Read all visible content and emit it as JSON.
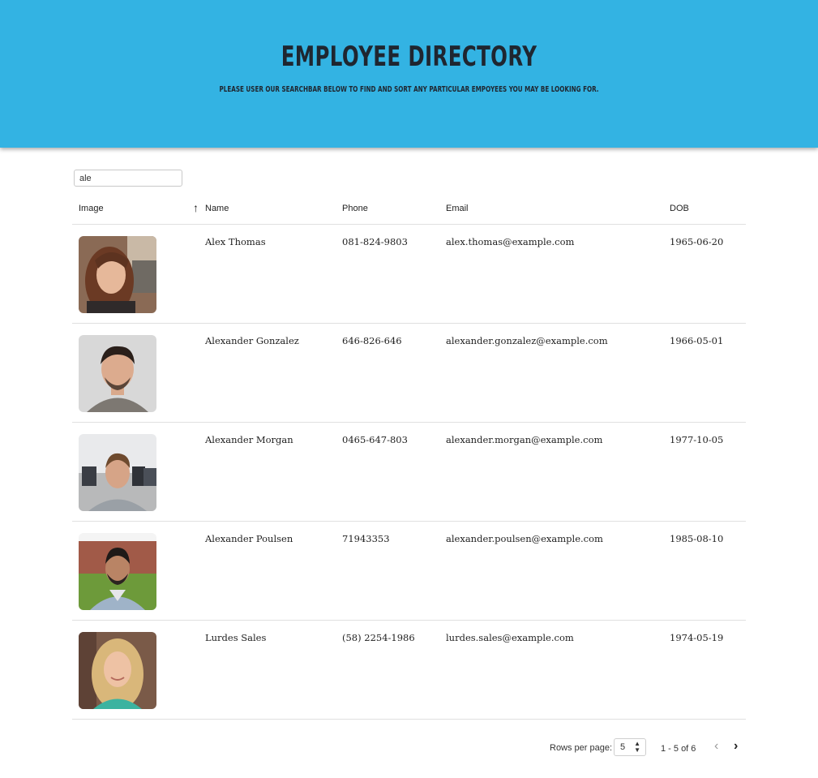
{
  "header": {
    "title": "EMPLOYEE DIRECTORY",
    "subtitle": "PLEASE USER OUR SEARCHBAR BELOW TO FIND AND SORT ANY PARTICULAR EMPOYEES YOU MAY BE LOOKING FOR.",
    "background_color": "#33b3e3"
  },
  "search": {
    "value": "ale"
  },
  "table": {
    "columns": [
      "Image",
      "Name",
      "Phone",
      "Email",
      "DOB"
    ],
    "sort": {
      "column": "Name",
      "direction": "ascending",
      "icon": "arrow-up-icon"
    },
    "rows": [
      {
        "image": "employee-photo",
        "name": "Alex Thomas",
        "phone": "081-824-9803",
        "email": "alex.thomas@example.com",
        "dob": "1965-06-20"
      },
      {
        "image": "employee-photo",
        "name": "Alexander Gonzalez",
        "phone": "646-826-646",
        "email": "alexander.gonzalez@example.com",
        "dob": "1966-05-01"
      },
      {
        "image": "employee-photo",
        "name": "Alexander Morgan",
        "phone": "0465-647-803",
        "email": "alexander.morgan@example.com",
        "dob": "1977-10-05"
      },
      {
        "image": "employee-photo",
        "name": "Alexander Poulsen",
        "phone": "71943353",
        "email": "alexander.poulsen@example.com",
        "dob": "1985-08-10"
      },
      {
        "image": "employee-photo",
        "name": "Lurdes Sales",
        "phone": "(58) 2254-1986",
        "email": "lurdes.sales@example.com",
        "dob": "1974-05-19"
      }
    ]
  },
  "pagination": {
    "rows_per_page_label": "Rows per page:",
    "rows_per_page_value": "5",
    "range_text": "1 - 5 of 6",
    "prev_icon": "chevron-left-icon",
    "next_icon": "chevron-right-icon"
  }
}
